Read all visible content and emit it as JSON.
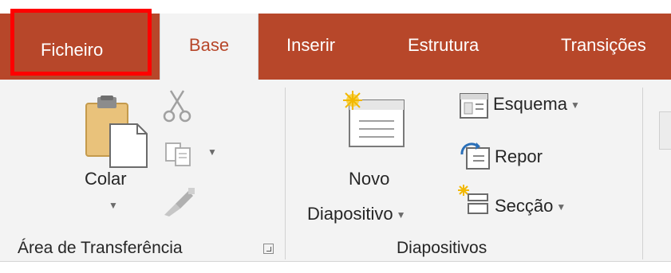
{
  "tabs": {
    "file": "Ficheiro",
    "home": "Base",
    "insert": "Inserir",
    "design": "Estrutura",
    "transitions": "Transições"
  },
  "clipboard": {
    "paste_label": "Colar",
    "group_label": "Área de Transferência",
    "icons": [
      "paste-icon",
      "cut-icon",
      "copy-icon",
      "format-painter-icon"
    ]
  },
  "slides": {
    "new_slide_line1": "Novo",
    "new_slide_line2": "Diapositivo",
    "layout_label": "Esquema",
    "reset_label": "Repor",
    "section_label": "Secção",
    "group_label": "Diapositivos",
    "icons": [
      "new-slide-icon",
      "layout-icon",
      "reset-icon",
      "section-icon"
    ]
  },
  "colors": {
    "tab_bar": "#b7472a",
    "ribbon_bg": "#f3f3f3",
    "highlight": "#ff0000"
  }
}
